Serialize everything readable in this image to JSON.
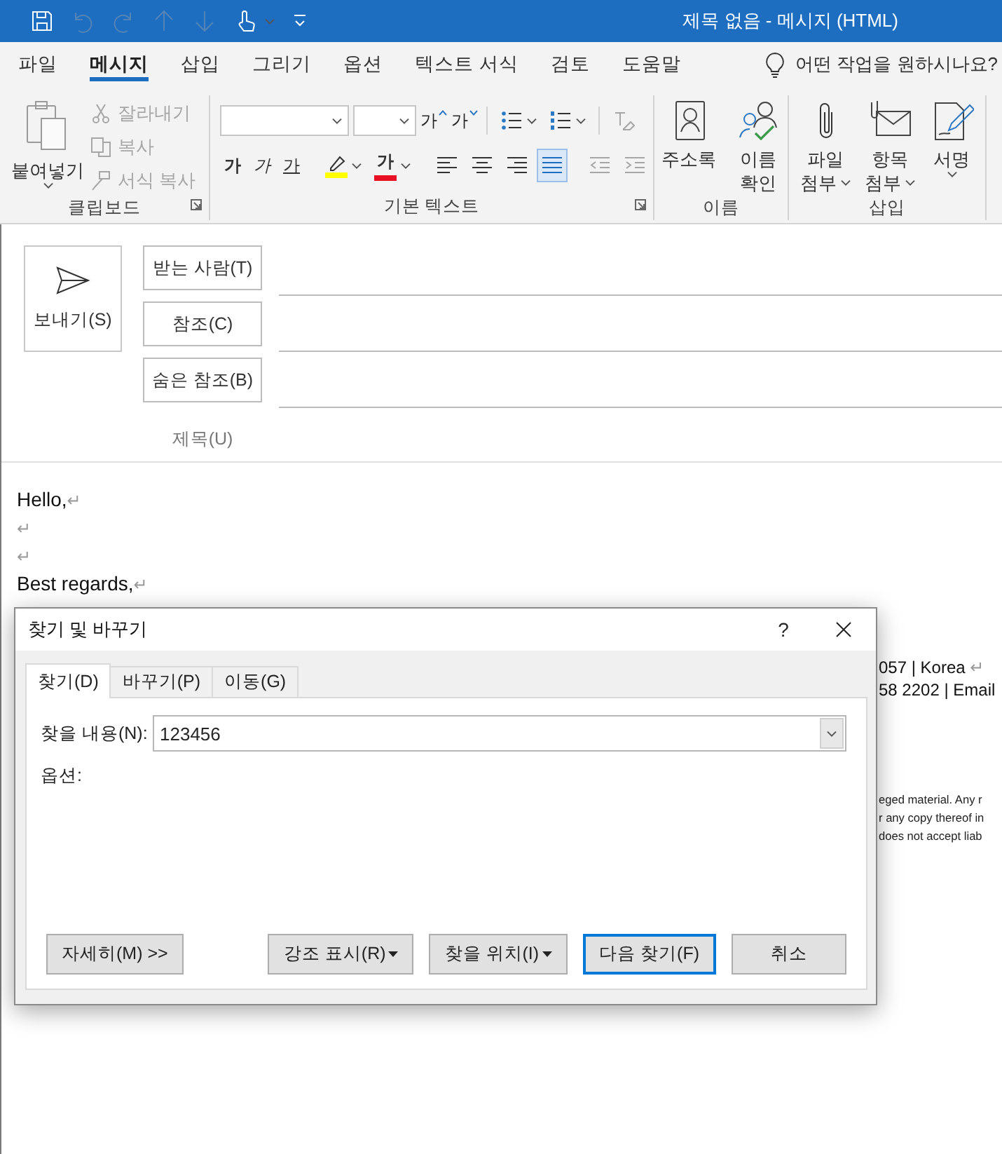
{
  "window": {
    "title": "제목 없음 - 메시지 (HTML)"
  },
  "quick_access": [
    {
      "kind": "save",
      "disabled": false
    },
    {
      "kind": "undo",
      "disabled": true
    },
    {
      "kind": "redo",
      "disabled": true
    },
    {
      "kind": "up",
      "disabled": true
    },
    {
      "kind": "down",
      "disabled": true
    },
    {
      "kind": "touch",
      "disabled": false,
      "dropdown": true
    },
    {
      "kind": "customize",
      "disabled": false
    }
  ],
  "ribbon_tabs": [
    {
      "label": "파일",
      "selected": false
    },
    {
      "label": "메시지",
      "selected": true
    },
    {
      "label": "삽입",
      "selected": false
    },
    {
      "label": "그리기",
      "selected": false
    },
    {
      "label": "옵션",
      "selected": false
    },
    {
      "label": "텍스트 서식",
      "selected": false
    },
    {
      "label": "검토",
      "selected": false
    },
    {
      "label": "도움말",
      "selected": false
    }
  ],
  "tell_me": {
    "placeholder": "어떤 작업을 원하시나요?"
  },
  "clipboard": {
    "label": "클립보드",
    "launcher": true,
    "paste": {
      "label": "붙여넣기",
      "dropdown": true
    },
    "items": [
      {
        "kind": "cut",
        "label": "잘라내기",
        "disabled": true
      },
      {
        "kind": "copy",
        "label": "복사",
        "disabled": true
      },
      {
        "kind": "format_painter",
        "label": "서식 복사",
        "disabled": true
      }
    ]
  },
  "basic_text": {
    "label": "기본 텍스트",
    "launcher": true,
    "row1": [
      {
        "kind": "font_name"
      },
      {
        "kind": "font_size"
      },
      {
        "kind": "grow",
        "glyph": "가"
      },
      {
        "kind": "shrink",
        "glyph": "가"
      },
      {
        "kind": "sep"
      },
      {
        "kind": "bullets",
        "dropdown": true
      },
      {
        "kind": "numbering",
        "dropdown": true
      },
      {
        "kind": "sep"
      },
      {
        "kind": "clear",
        "disabled": true
      }
    ],
    "row2": [
      {
        "kind": "bold",
        "glyph": "가"
      },
      {
        "kind": "italic",
        "glyph": "가"
      },
      {
        "kind": "underline",
        "glyph": "가"
      },
      {
        "kind": "sep"
      },
      {
        "kind": "highlight",
        "color": "#ffff00",
        "dropdown": true
      },
      {
        "kind": "font_color",
        "glyph": "가",
        "color": "#e81123",
        "dropdown": true
      },
      {
        "kind": "sep"
      },
      {
        "kind": "align_left",
        "selected": false
      },
      {
        "kind": "align_center",
        "selected": false
      },
      {
        "kind": "align_right",
        "selected": false
      },
      {
        "kind": "justify",
        "selected": true
      },
      {
        "kind": "sep"
      },
      {
        "kind": "outdent",
        "disabled": true
      },
      {
        "kind": "indent",
        "disabled": true
      }
    ]
  },
  "names": {
    "label": "이름",
    "buttons": [
      {
        "kind": "address_book",
        "lines": [
          "주소록"
        ],
        "dropdown": false
      },
      {
        "kind": "check_names",
        "lines": [
          "이름",
          "확인"
        ],
        "dropdown": false
      }
    ]
  },
  "insert": {
    "label": "삽입",
    "buttons": [
      {
        "kind": "attach_file",
        "lines": [
          "파일",
          "첨부"
        ],
        "dropdown": true
      },
      {
        "kind": "attach_item",
        "lines": [
          "항목",
          "첨부"
        ],
        "dropdown": true
      },
      {
        "kind": "signature",
        "lines": [
          "서명"
        ],
        "dropdown": true
      }
    ]
  },
  "compose": {
    "send": {
      "label": "보내기(S)"
    },
    "recipients": [
      {
        "label": "받는 사람(T)"
      },
      {
        "label": "참조(C)"
      },
      {
        "label": "숨은 참조(B)"
      }
    ],
    "subject": {
      "label": "제목(U)"
    }
  },
  "body": {
    "lines": [
      {
        "text": "Hello,",
        "mark": "↵"
      },
      {
        "mark": "↵"
      },
      {
        "mark": "↵"
      },
      {
        "text": "Best regards,",
        "mark": "↵"
      }
    ],
    "covered_lines": [
      {
        "text": "057 | Korea",
        "mark": "↵"
      },
      {
        "text": "58 2202 | Email"
      }
    ],
    "fine_print": [
      "eged material. Any r",
      "r any copy thereof in",
      "does not accept liab"
    ]
  },
  "find_dialog": {
    "title": "찾기 및 바꾸기",
    "help": "?",
    "tabs": [
      {
        "label": "찾기(D)",
        "selected": true
      },
      {
        "label": "바꾸기(P)",
        "selected": false
      },
      {
        "label": "이동(G)",
        "selected": false
      }
    ],
    "find_what": {
      "label": "찾을 내용(N):",
      "value": "123456"
    },
    "options_label": "옵션:",
    "buttons": [
      {
        "label": "자세히(M) >>",
        "dropdown": false,
        "default": false
      },
      {
        "label": "강조 표시(R)",
        "dropdown": true,
        "default": false
      },
      {
        "label": "찾을 위치(I)",
        "dropdown": true,
        "default": false
      },
      {
        "label": "다음 찾기(F)",
        "dropdown": false,
        "default": true
      },
      {
        "label": "취소",
        "dropdown": false,
        "default": false
      }
    ]
  }
}
